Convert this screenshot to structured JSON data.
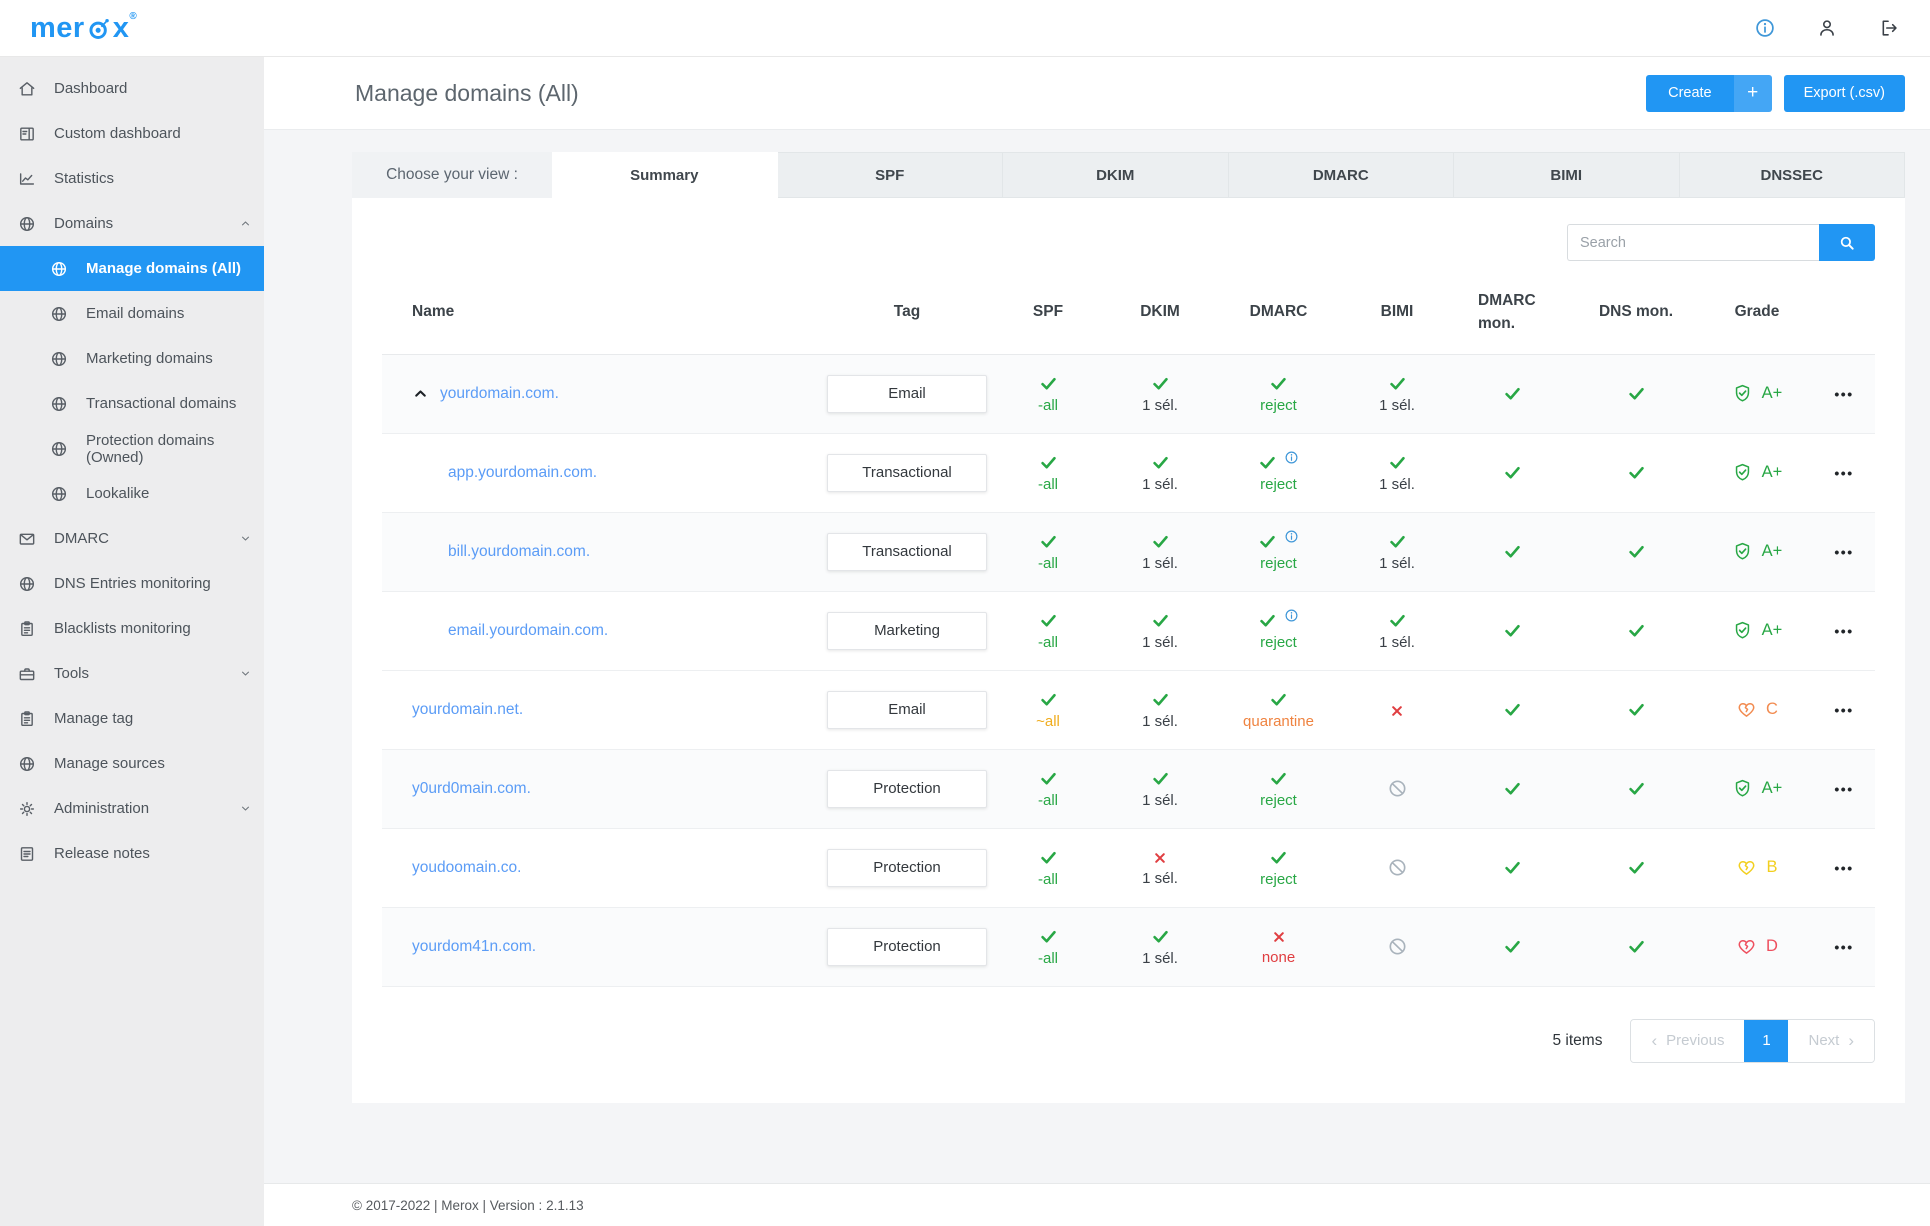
{
  "brand": {
    "name_pre": "mer",
    "name_post": "x",
    "registered": "®"
  },
  "topbar": {
    "icons": [
      {
        "name": "info"
      },
      {
        "name": "user"
      },
      {
        "name": "logout"
      }
    ]
  },
  "sidebar": {
    "items": [
      {
        "label": "Dashboard",
        "icon": "home"
      },
      {
        "label": "Custom dashboard",
        "icon": "doc"
      },
      {
        "label": "Statistics",
        "icon": "chart"
      },
      {
        "label": "Domains",
        "icon": "globe",
        "chevron": "up"
      },
      {
        "label": "Manage domains (All)",
        "icon": "globe",
        "child": true,
        "active": true
      },
      {
        "label": "Email domains",
        "icon": "globe",
        "child": true
      },
      {
        "label": "Marketing domains",
        "icon": "globe",
        "child": true
      },
      {
        "label": "Transactional domains",
        "icon": "globe",
        "child": true
      },
      {
        "label": "Protection domains (Owned)",
        "icon": "globe",
        "child": true
      },
      {
        "label": "Lookalike",
        "icon": "globe",
        "child": true
      },
      {
        "label": "DMARC",
        "icon": "mail",
        "chevron": "down"
      },
      {
        "label": "DNS Entries monitoring",
        "icon": "globe"
      },
      {
        "label": "Blacklists monitoring",
        "icon": "clipboard"
      },
      {
        "label": "Tools",
        "icon": "briefcase",
        "chevron": "down"
      },
      {
        "label": "Manage tag",
        "icon": "clipboard"
      },
      {
        "label": "Manage sources",
        "icon": "globe"
      },
      {
        "label": "Administration",
        "icon": "gear",
        "chevron": "down"
      },
      {
        "label": "Release notes",
        "icon": "notes"
      }
    ]
  },
  "page": {
    "title": "Manage domains (All)",
    "create_label": "Create",
    "create_plus": "+",
    "export_label": "Export (.csv)"
  },
  "view": {
    "label": "Choose your view :",
    "tabs": [
      {
        "label": "Summary",
        "active": true
      },
      {
        "label": "SPF"
      },
      {
        "label": "DKIM"
      },
      {
        "label": "DMARC"
      },
      {
        "label": "BIMI"
      },
      {
        "label": "DNSSEC"
      }
    ]
  },
  "search": {
    "placeholder": "Search"
  },
  "table": {
    "columns": [
      "Name",
      "Tag",
      "SPF",
      "DKIM",
      "DMARC",
      "BIMI",
      "DMARC mon.",
      "DNS mon.",
      "Grade"
    ],
    "row_menu": "•••",
    "rows": [
      {
        "name": "yourdomain.com.",
        "indent": 0,
        "expand": "up",
        "shaded": true,
        "tag": "Email",
        "spf": {
          "icon": "check",
          "text": "-all",
          "color": "green"
        },
        "dkim": {
          "icon": "check",
          "text": "1 sél.",
          "color": "dark"
        },
        "dmarc": {
          "icon": "check",
          "text": "reject",
          "color": "green"
        },
        "bimi": {
          "icon": "check",
          "text": "1 sél.",
          "color": "dark"
        },
        "dmarc_mon": {
          "icon": "check"
        },
        "dns_mon": {
          "icon": "check"
        },
        "grade": {
          "icon": "shield",
          "letter": "A+",
          "color": "green"
        }
      },
      {
        "name": "app.yourdomain.com.",
        "indent": 1,
        "shaded": false,
        "tag": "Transactional",
        "spf": {
          "icon": "check",
          "text": "-all",
          "color": "green"
        },
        "dkim": {
          "icon": "check",
          "text": "1 sél.",
          "color": "dark"
        },
        "dmarc": {
          "icon": "check",
          "info": true,
          "text": "reject",
          "color": "green"
        },
        "bimi": {
          "icon": "check",
          "text": "1 sél.",
          "color": "dark"
        },
        "dmarc_mon": {
          "icon": "check"
        },
        "dns_mon": {
          "icon": "check"
        },
        "grade": {
          "icon": "shield",
          "letter": "A+",
          "color": "green"
        }
      },
      {
        "name": "bill.yourdomain.com.",
        "indent": 1,
        "shaded": true,
        "tag": "Transactional",
        "spf": {
          "icon": "check",
          "text": "-all",
          "color": "green"
        },
        "dkim": {
          "icon": "check",
          "text": "1 sél.",
          "color": "dark"
        },
        "dmarc": {
          "icon": "check",
          "info": true,
          "text": "reject",
          "color": "green"
        },
        "bimi": {
          "icon": "check",
          "text": "1 sél.",
          "color": "dark"
        },
        "dmarc_mon": {
          "icon": "check"
        },
        "dns_mon": {
          "icon": "check"
        },
        "grade": {
          "icon": "shield",
          "letter": "A+",
          "color": "green"
        }
      },
      {
        "name": "email.yourdomain.com.",
        "indent": 1,
        "shaded": false,
        "tag": "Marketing",
        "spf": {
          "icon": "check",
          "text": "-all",
          "color": "green"
        },
        "dkim": {
          "icon": "check",
          "text": "1 sél.",
          "color": "dark"
        },
        "dmarc": {
          "icon": "check",
          "info": true,
          "text": "reject",
          "color": "green"
        },
        "bimi": {
          "icon": "check",
          "text": "1 sél.",
          "color": "dark"
        },
        "dmarc_mon": {
          "icon": "check"
        },
        "dns_mon": {
          "icon": "check"
        },
        "grade": {
          "icon": "shield",
          "letter": "A+",
          "color": "green"
        }
      },
      {
        "name": "yourdomain.net.",
        "indent": 0,
        "shaded": false,
        "tag": "Email",
        "spf": {
          "icon": "check",
          "text": "~all",
          "color": "gold"
        },
        "dkim": {
          "icon": "check",
          "text": "1 sél.",
          "color": "dark"
        },
        "dmarc": {
          "icon": "check",
          "text": "quarantine",
          "color": "orange"
        },
        "bimi": {
          "icon": "cross"
        },
        "dmarc_mon": {
          "icon": "check"
        },
        "dns_mon": {
          "icon": "check"
        },
        "grade": {
          "icon": "heart",
          "letter": "C",
          "color": "c"
        }
      },
      {
        "name": "y0urd0main.com.",
        "indent": 0,
        "shaded": true,
        "tag": "Protection",
        "spf": {
          "icon": "check",
          "text": "-all",
          "color": "green"
        },
        "dkim": {
          "icon": "check",
          "text": "1 sél.",
          "color": "dark"
        },
        "dmarc": {
          "icon": "check",
          "text": "reject",
          "color": "green"
        },
        "bimi": {
          "icon": "blocked"
        },
        "dmarc_mon": {
          "icon": "check"
        },
        "dns_mon": {
          "icon": "check"
        },
        "grade": {
          "icon": "shield",
          "letter": "A+",
          "color": "green"
        }
      },
      {
        "name": "youdoomain.co.",
        "indent": 0,
        "shaded": false,
        "tag": "Protection",
        "spf": {
          "icon": "check",
          "text": "-all",
          "color": "green"
        },
        "dkim": {
          "icon": "cross",
          "text": "1 sél.",
          "color": "dark"
        },
        "dmarc": {
          "icon": "check",
          "text": "reject",
          "color": "green"
        },
        "bimi": {
          "icon": "blocked"
        },
        "dmarc_mon": {
          "icon": "check"
        },
        "dns_mon": {
          "icon": "check"
        },
        "grade": {
          "icon": "heart",
          "letter": "B",
          "color": "b"
        }
      },
      {
        "name": "yourdom41n.com.",
        "indent": 0,
        "shaded": true,
        "tag": "Protection",
        "spf": {
          "icon": "check",
          "text": "-all",
          "color": "green"
        },
        "dkim": {
          "icon": "check",
          "text": "1 sél.",
          "color": "dark"
        },
        "dmarc": {
          "icon": "cross",
          "text": "none",
          "color": "red"
        },
        "bimi": {
          "icon": "blocked"
        },
        "dmarc_mon": {
          "icon": "check"
        },
        "dns_mon": {
          "icon": "check"
        },
        "grade": {
          "icon": "heart",
          "letter": "D",
          "color": "d"
        }
      }
    ]
  },
  "pagination": {
    "items_text": "5 items",
    "prev_arrow": "‹",
    "prev_label": "Previous",
    "page": "1",
    "next_label": "Next",
    "next_arrow": "›"
  },
  "footer": {
    "copyright": "© 2017-2022 | Merox | Version : 2.1.13"
  },
  "colors": {
    "accent": "#2196f3",
    "link": "#5b9cf6",
    "green": "#28a745",
    "red": "#e03e41",
    "orange": "#ef8340",
    "gold": "#f0ad1f",
    "grade_c": "#f28b50",
    "grade_b": "#f2cf1f",
    "grade_d": "#ee4f5e",
    "blocked": "#a9b3bc",
    "info": "#3f97d8"
  }
}
